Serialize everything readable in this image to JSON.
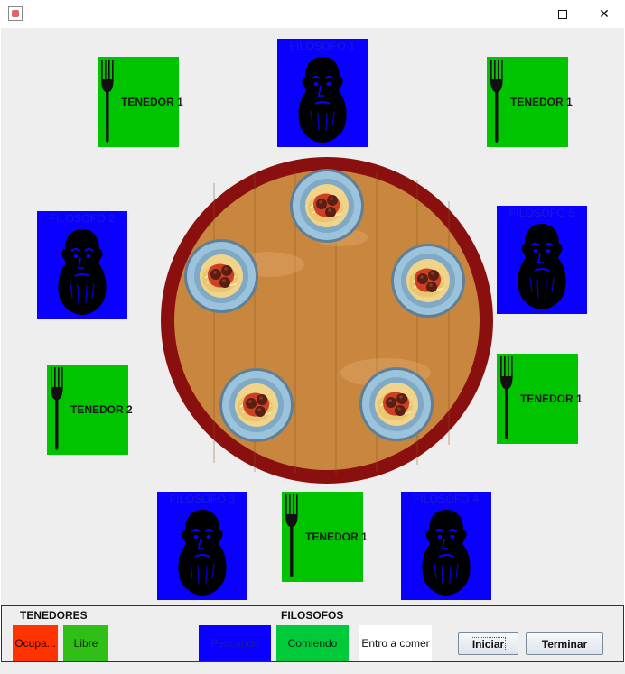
{
  "window": {
    "title": ""
  },
  "philosophers": [
    {
      "name": "FILOSOFO 1",
      "state": "Pensando"
    },
    {
      "name": "FILOSOFO 2",
      "state": "Pensando"
    },
    {
      "name": "FILOSOFO 3",
      "state": "Pensando"
    },
    {
      "name": "FILOSOFO 4",
      "state": "Pensando"
    },
    {
      "name": "FILOSOFO 5",
      "state": "Pensando"
    }
  ],
  "forks": [
    {
      "label": "TENEDOR 1",
      "state": "Libre"
    },
    {
      "label": "TENEDOR 1",
      "state": "Libre"
    },
    {
      "label": "TENEDOR 2",
      "state": "Libre"
    },
    {
      "label": "TENEDOR 1",
      "state": "Libre"
    },
    {
      "label": "TENEDOR 1",
      "state": "Libre"
    }
  ],
  "legend": {
    "forks_title": "TENEDORES",
    "philosophers_title": "FILOSOFOS",
    "occupied": "Ocupa...",
    "free": "Libre",
    "thinking": "Pensando",
    "eating": "Comiendo",
    "entering": "Entro a comer"
  },
  "buttons": {
    "start": "Iniciar",
    "stop": "Terminar"
  },
  "colors": {
    "occupied": "#ff3300",
    "free": "#2fbf16",
    "thinking": "#0a00ff",
    "eating": "#00c93a",
    "entering": "#ffffff",
    "fork_tile": "#00c400",
    "philosopher_tile": "#0a00ff",
    "table_rim": "#8a0f0f",
    "table_wood": "#c9863e"
  },
  "icons": {
    "fork": "fork-icon",
    "philosopher": "philosopher-portrait-icon",
    "plate": "spaghetti-plate-icon",
    "table": "round-table-icon"
  }
}
